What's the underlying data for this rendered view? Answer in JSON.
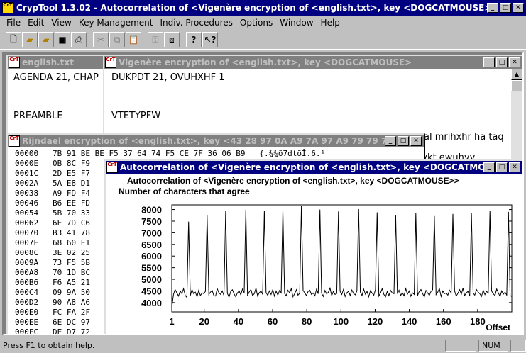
{
  "app": {
    "title": "CrypTool 1.3.02 - Autocorrelation of <Vigenère encryption of <english.txt>, key <DOGCATMOUSE>>",
    "icon_text": "CrT"
  },
  "menu": [
    "File",
    "Edit",
    "View",
    "Key Management",
    "Indiv. Procedures",
    "Options",
    "Window",
    "Help"
  ],
  "toolbar": {
    "icons": [
      "new-document-icon",
      "open-folder-icon",
      "open-folder-2-icon",
      "save-icon",
      "print-icon",
      "cut-icon",
      "copy-icon",
      "paste-icon",
      "encrypt-icon",
      "window-icon",
      "help-icon",
      "context-help-icon"
    ]
  },
  "windows": {
    "english": {
      "title": "english.txt",
      "lines": [
        "AGENDA 21, CHAP",
        "",
        "",
        "PREAMBLE"
      ]
    },
    "vigenere": {
      "title": "Vigenère encryption of <english.txt>, key <DOGCATMOUSE>",
      "lines": [
        "DUKPDT 21, OVUHXHF 1",
        "",
        "",
        "VTETYPFW"
      ],
      "right_frag1": "al mrihxhr ha taq",
      "right_frag2": "rykt ewuhyv"
    },
    "rijndael": {
      "title": "Rijndael encryption of <english.txt>, key <43 28 97 0A A9 7A 97 A9 79 79 7F 9F 79 87 ...",
      "rows": [
        {
          "off": "00000",
          "hex": "7B 91 BE BE F5 37 64 74 F5 CE 7F 36 06 B9",
          "asc": "{.¾¾õ7dtõÎ.6.¹"
        },
        {
          "off": "0000E",
          "hex": "0B 8C F9"
        },
        {
          "off": "0001C",
          "hex": "2D E5 F7"
        },
        {
          "off": "0002A",
          "hex": "5A E8 D1"
        },
        {
          "off": "00038",
          "hex": "A9 FD F4"
        },
        {
          "off": "00046",
          "hex": "B6 EE FD"
        },
        {
          "off": "00054",
          "hex": "5B 70 33"
        },
        {
          "off": "00062",
          "hex": "6E 7D C6"
        },
        {
          "off": "00070",
          "hex": "B3 41 78"
        },
        {
          "off": "0007E",
          "hex": "68 60 E1"
        },
        {
          "off": "0008C",
          "hex": "3E 02 25"
        },
        {
          "off": "0009A",
          "hex": "73 F5 5B"
        },
        {
          "off": "000A8",
          "hex": "70 1D BC"
        },
        {
          "off": "000B6",
          "hex": "F6 A5 21"
        },
        {
          "off": "000C4",
          "hex": "09 9A 50"
        },
        {
          "off": "000D2",
          "hex": "90 A8 A6"
        },
        {
          "off": "000E0",
          "hex": "FC FA 2F"
        },
        {
          "off": "000EE",
          "hex": "6E DC 97"
        },
        {
          "off": "000FC",
          "hex": "DE D7 72"
        },
        {
          "off": "0010A",
          "hex": "16 57 D0"
        }
      ]
    },
    "autocorr": {
      "title": "Autocorrelation of <Vigenère encryption of <english.txt>, key <DOGCATMOUSE>>"
    }
  },
  "chart_data": {
    "type": "line",
    "title": "Autocorrelation of <Vigenère encryption of <english.txt>, key <DOGCATMOUSE>>",
    "ylabel": "Number of characters that agree",
    "xlabel": "Offset",
    "xlim": [
      1,
      200
    ],
    "ylim": [
      3600,
      8200
    ],
    "xticks": [
      1,
      20,
      40,
      60,
      80,
      100,
      120,
      140,
      160,
      180
    ],
    "yticks": [
      4000,
      4500,
      5000,
      5500,
      6000,
      6500,
      7000,
      7500,
      8000
    ],
    "series": [
      {
        "values": [
          3790,
          4350,
          4560,
          4420,
          4280,
          4500,
          4380,
          4600,
          4300,
          4220,
          7480,
          4300,
          4560,
          4380,
          4450,
          4250,
          4520,
          4300,
          4420,
          4380,
          4480,
          7750,
          4350,
          4450,
          4520,
          4300,
          4280,
          4600,
          4420,
          4350,
          4500,
          4300,
          7950,
          4400,
          4230,
          4470,
          4550,
          4380,
          4250,
          4420,
          4500,
          4330,
          4580,
          4420,
          8000,
          4300,
          4460,
          4560,
          4300,
          4380,
          4620,
          4280,
          4420,
          4500,
          4350,
          7950,
          4430,
          4310,
          4500,
          4350,
          4560,
          4280,
          4490,
          4320,
          4520,
          4420,
          7980,
          4390,
          4290,
          4530,
          4420,
          4600,
          4250,
          4380,
          4550,
          4320,
          4400,
          8140,
          4510,
          4420,
          4300,
          4480,
          4530,
          4350,
          4410,
          4290,
          4580,
          4380,
          8000,
          4400,
          4260,
          4520,
          4370,
          4440,
          4620,
          4300,
          4480,
          4350,
          4390,
          7920,
          4480,
          4350,
          4570,
          4260,
          4420,
          4480,
          4300,
          4540,
          4390,
          4330,
          4500,
          8020,
          4450,
          4300,
          4580,
          4360,
          4480,
          4250,
          4510,
          4410,
          4320,
          4550,
          7880,
          4280,
          4410,
          4600,
          4350,
          4250,
          4480,
          4300,
          4520,
          4410,
          4380,
          7750,
          4380,
          4530,
          4310,
          4420,
          4290,
          4600,
          4360,
          4500,
          4270,
          4420,
          4350,
          7850,
          4300,
          4480,
          4560,
          4390,
          4240,
          4520,
          4420,
          4310,
          4480,
          4550,
          7720,
          4340,
          4450,
          4600,
          4260,
          4500,
          4380,
          4420,
          4320,
          4530,
          4410,
          7810,
          4500,
          4280,
          4400,
          4550,
          4360,
          4620,
          4300,
          4420,
          4480,
          4270,
          7850,
          4400,
          4320,
          4560,
          4450,
          4380,
          4260,
          4530,
          4340,
          4480,
          4410,
          7950,
          4500,
          4380,
          4300,
          4580,
          4420,
          4260,
          4500,
          4360,
          4450,
          4320,
          7900,
          4300,
          4260
        ]
      }
    ]
  },
  "status": {
    "text": "Press F1 to obtain help.",
    "num": "NUM"
  }
}
